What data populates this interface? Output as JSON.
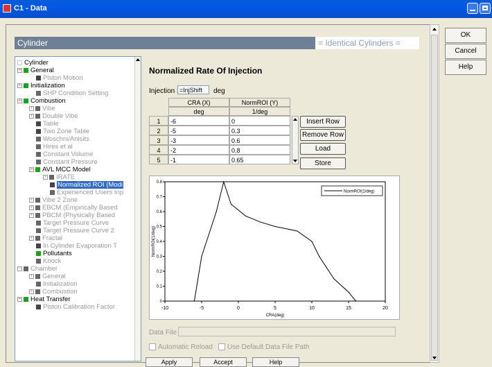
{
  "window": {
    "title": "C1 - Data"
  },
  "header": {
    "left": "Cylinder",
    "right": "= Identical Cylinders ="
  },
  "tree": {
    "items": [
      {
        "label": "Cylinder"
      },
      {
        "label": "General"
      },
      {
        "label": "Piston Motion"
      },
      {
        "label": "Initialization"
      },
      {
        "label": "SHP Condition Setting"
      },
      {
        "label": "Combustion"
      },
      {
        "label": "Vibe"
      },
      {
        "label": "Double Vibe"
      },
      {
        "label": "Table"
      },
      {
        "label": "Two Zone Table"
      },
      {
        "label": "Woschni/Anisits"
      },
      {
        "label": "Hires et al"
      },
      {
        "label": "Constant Volume"
      },
      {
        "label": "Constant Pressure"
      },
      {
        "label": "AVL MCC Model"
      },
      {
        "label": "IRATE"
      },
      {
        "label": "Normalized ROI (Modi"
      },
      {
        "label": "Experienced Users Inp"
      },
      {
        "label": "Vibe 2 Zone"
      },
      {
        "label": "EBCM (Empirically Based"
      },
      {
        "label": "PBCM (Physically Based"
      },
      {
        "label": "Target Pressure Curve"
      },
      {
        "label": "Target Pressure Curve 2"
      },
      {
        "label": "Fractal"
      },
      {
        "label": "In Cylinder Evaporation T"
      },
      {
        "label": "Pollutants"
      },
      {
        "label": "Knock"
      },
      {
        "label": "Chamber"
      },
      {
        "label": "General"
      },
      {
        "label": "Initialization"
      },
      {
        "label": "Combustion"
      },
      {
        "label": "Heat Transfer"
      },
      {
        "label": "Piston Calibration Factor"
      }
    ]
  },
  "main": {
    "section_title": "Normalized Rate Of Injection",
    "injection_shift": {
      "label": "Injection Shift",
      "value": "=InjShift",
      "unit": "deg"
    },
    "table": {
      "col_headers": [
        "CRA (X)",
        "NormROI (Y)"
      ],
      "col_units": [
        "deg",
        "1/deg"
      ],
      "rows": [
        {
          "n": "1",
          "x": "-6",
          "y": "0"
        },
        {
          "n": "2",
          "x": "-5",
          "y": "0.3"
        },
        {
          "n": "3",
          "x": "-3",
          "y": "0.6"
        },
        {
          "n": "4",
          "x": "-2",
          "y": "0.8"
        },
        {
          "n": "5",
          "x": "-1",
          "y": "0.65"
        }
      ]
    },
    "buttons": {
      "insert_row": "Insert Row",
      "remove_row": "Remove Row",
      "load": "Load",
      "store": "Store"
    },
    "data_file_label": "Data File",
    "auto_reload_label": "Automatic Reload",
    "default_path_label": "Use Default Data File Path",
    "bottom_buttons": [
      "Apply",
      "Accept",
      "Help"
    ]
  },
  "side_buttons": {
    "ok": "OK",
    "cancel": "Cancel",
    "help": "Help"
  },
  "chart_data": {
    "type": "line",
    "xlabel": "CRA(deg)",
    "ylabel": "NormROI(1/deg)",
    "xlim": [
      -10,
      20
    ],
    "ylim": [
      0,
      0.8
    ],
    "x_ticks": [
      "-10",
      "-5",
      "0",
      "5",
      "10",
      "15",
      "20"
    ],
    "y_ticks": [
      "0",
      "0.1",
      "0.2",
      "0.3",
      "0.4",
      "0.5",
      "0.6",
      "0.7",
      "0.8"
    ],
    "legend_position": "top-right",
    "series": [
      {
        "name": "NormROI(1/deg)",
        "x": [
          -6,
          -5,
          -3,
          -2,
          -1,
          1,
          3,
          5,
          7,
          8,
          10,
          11,
          13,
          15,
          16
        ],
        "y": [
          0,
          0.3,
          0.6,
          0.8,
          0.65,
          0.57,
          0.53,
          0.5,
          0.48,
          0.47,
          0.4,
          0.3,
          0.15,
          0.06,
          0
        ]
      }
    ]
  }
}
